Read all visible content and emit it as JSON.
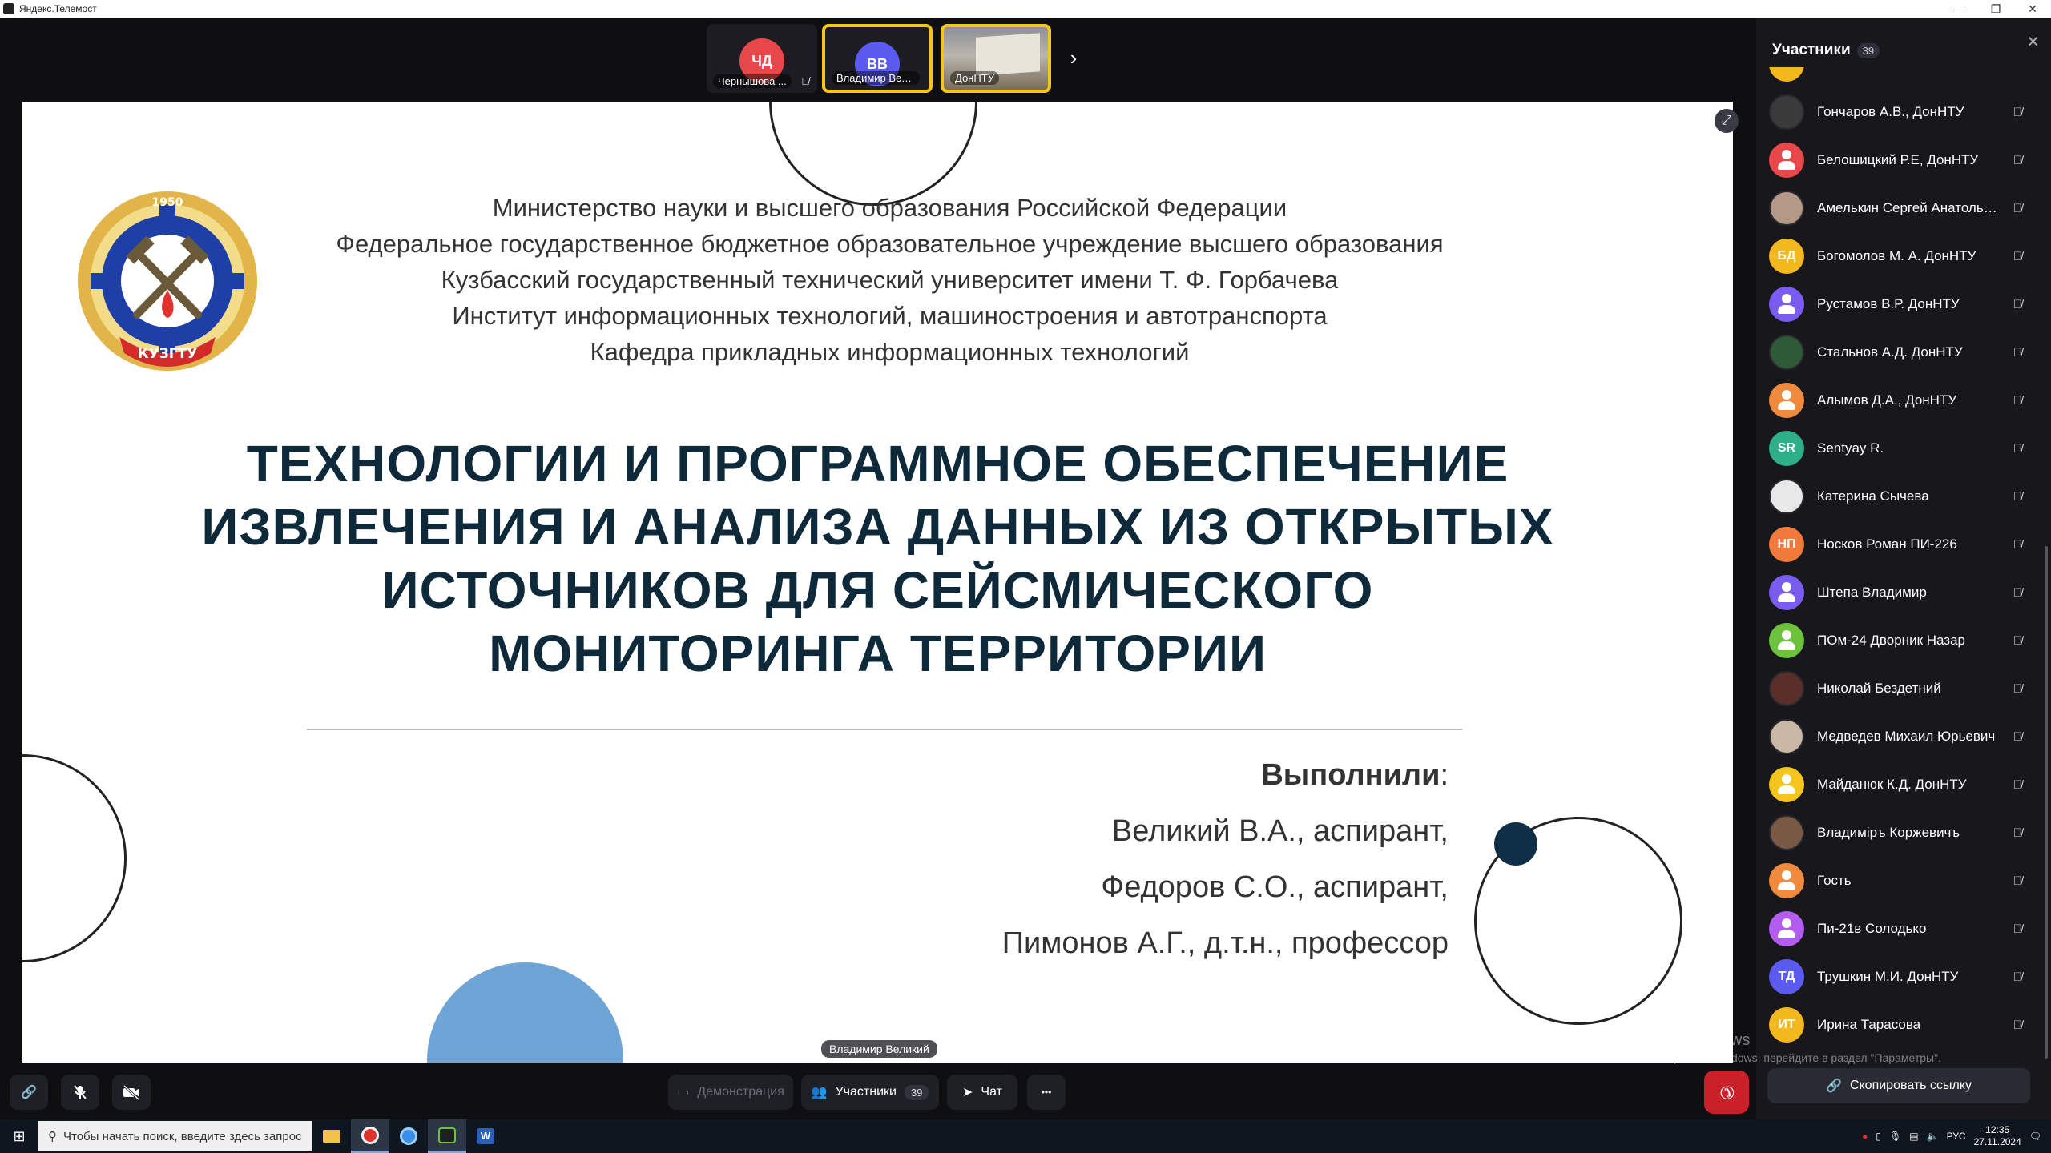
{
  "window": {
    "title": "Яндекс.Телемост",
    "controls": [
      "—",
      "❐",
      "✕"
    ]
  },
  "strip": {
    "tiles": [
      {
        "initials": "ЧД",
        "name": "Чернышова ...",
        "color": "#e9484a",
        "muted": true
      },
      {
        "initials": "ВВ",
        "name": "Владимир Вели...",
        "color": "#5b5bf0",
        "muted": false,
        "active": true
      },
      {
        "initials": "",
        "name": "ДонНТУ",
        "video": true,
        "active": true
      }
    ],
    "next_icon": "›"
  },
  "slide": {
    "header_lines": [
      "Министерство науки и высшего образования Российской Федерации",
      "Федеральное государственное бюджетное образовательное учреждение высшего образования",
      "Кузбасский государственный технический университет имени Т. Ф. Горбачева",
      "Институт информационных технологий, машиностроения и автотранспорта",
      "Кафедра прикладных информационных технологий"
    ],
    "title_lines": [
      "ТЕХНОЛОГИИ И ПРОГРАММНОЕ ОБЕСПЕЧЕНИЕ",
      "ИЗВЛЕЧЕНИЯ И АНАЛИЗА ДАННЫХ ИЗ ОТКРЫТЫХ",
      "ИСТОЧНИКОВ ДЛЯ СЕЙСМИЧЕСКОГО",
      "МОНИТОРИНГА ТЕРРИТОРИИ"
    ],
    "authors_label": "Выполнили",
    "authors": [
      "Великий В.А., аспирант,",
      "Федоров С.О., аспирант,",
      "Пимонов А.Г., д.т.н., профессор"
    ],
    "logo": {
      "year": "1950",
      "text": "КУЗГТУ"
    }
  },
  "panel": {
    "title": "Участники",
    "count": "39",
    "copy_link_label": "Скопировать ссылку",
    "participants": [
      {
        "name": "Гончаров А.В., ДонНТУ",
        "kind": "photo",
        "color": "#3a3a3a"
      },
      {
        "name": "Белошицкий Р.Е, ДонНТУ",
        "kind": "silhouette",
        "color": "#e9484a"
      },
      {
        "name": "Амелькин Сергей Анатолье...",
        "kind": "photo",
        "color": "#b49a86"
      },
      {
        "name": "Богомолов М. А. ДонНТУ",
        "kind": "initials",
        "initials": "БД",
        "color": "#f3b81d"
      },
      {
        "name": "Рустамов В.Р. ДонНТУ",
        "kind": "silhouette",
        "color": "#7b5cf0"
      },
      {
        "name": "Стальнов А.Д. ДонНТУ",
        "kind": "photo",
        "color": "#2f5a38"
      },
      {
        "name": "Алымов Д.А., ДонНТУ",
        "kind": "silhouette",
        "color": "#f08a3c"
      },
      {
        "name": "Sentyay R.",
        "kind": "initials",
        "initials": "SR",
        "color": "#2fae8a"
      },
      {
        "name": "Катерина Сычева",
        "kind": "photo",
        "color": "#e8e8e8"
      },
      {
        "name": "Носков Роман ПИ-226",
        "kind": "initials",
        "initials": "НП",
        "color": "#f07a3c"
      },
      {
        "name": "Штепа Владимир",
        "kind": "silhouette",
        "color": "#7b5cf0"
      },
      {
        "name": "ПОм-24 Дворник Назар",
        "kind": "silhouette",
        "color": "#6cc23b"
      },
      {
        "name": "Николай Бездетний",
        "kind": "photo",
        "color": "#5a2f2a"
      },
      {
        "name": "Медведев Михаил Юрьевич",
        "kind": "photo",
        "color": "#c9b8a6"
      },
      {
        "name": "Майданюк К.Д. ДонНТУ",
        "kind": "silhouette",
        "color": "#f3c51d"
      },
      {
        "name": "Владиміръ Коржевичъ",
        "kind": "photo",
        "color": "#7a5a44"
      },
      {
        "name": "Гость",
        "kind": "silhouette",
        "color": "#f08a3c"
      },
      {
        "name": "Пи-21в Солодько",
        "kind": "silhouette",
        "color": "#b25cf0"
      },
      {
        "name": "Трушкин М.И. ДонНТУ",
        "kind": "initials",
        "initials": "ТД",
        "color": "#5b5bf0"
      },
      {
        "name": "Ирина Тарасова",
        "kind": "initials",
        "initials": "ИТ",
        "color": "#f3b81d"
      }
    ]
  },
  "controls": {
    "demo_label": "Демонстрация",
    "participants_label": "Участники",
    "participants_count": "39",
    "chat_label": "Чат",
    "more_icon": "•••",
    "speaker_name": "Владимир Великий"
  },
  "watermark": {
    "line1": "Активация Windows",
    "line2": "Чтобы активировать Windows, перейдите в раздел \"Параметры\"."
  },
  "taskbar": {
    "search_placeholder": "Чтобы начать поиск, введите здесь запрос",
    "lang": "РУС",
    "time": "12:35",
    "date": "27.11.2024"
  }
}
